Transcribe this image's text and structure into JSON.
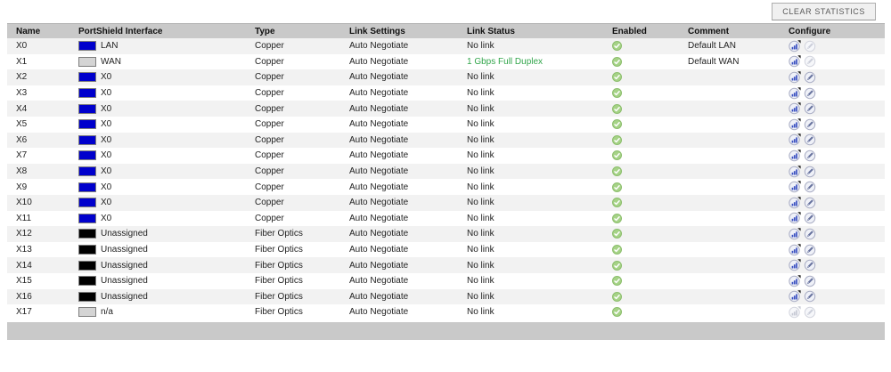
{
  "toolbar": {
    "clear_statistics_label": "CLEAR STATISTICS"
  },
  "table": {
    "columns": [
      "Name",
      "PortShield Interface",
      "Type",
      "Link Settings",
      "Link Status",
      "Enabled",
      "Comment",
      "Configure"
    ],
    "rows": [
      {
        "name": "X0",
        "portshield": {
          "color": "blue",
          "label": "LAN"
        },
        "type": "Copper",
        "link_settings": "Auto Negotiate",
        "link_status": "No link",
        "link_up": false,
        "enabled": true,
        "comment": "Default LAN",
        "configure": {
          "statistics": true,
          "edit": false
        }
      },
      {
        "name": "X1",
        "portshield": {
          "color": "gray",
          "label": "WAN"
        },
        "type": "Copper",
        "link_settings": "Auto Negotiate",
        "link_status": "1 Gbps Full Duplex",
        "link_up": true,
        "enabled": true,
        "comment": "Default WAN",
        "configure": {
          "statistics": true,
          "edit": false
        }
      },
      {
        "name": "X2",
        "portshield": {
          "color": "blue",
          "label": "X0"
        },
        "type": "Copper",
        "link_settings": "Auto Negotiate",
        "link_status": "No link",
        "link_up": false,
        "enabled": true,
        "comment": "",
        "configure": {
          "statistics": true,
          "edit": true
        }
      },
      {
        "name": "X3",
        "portshield": {
          "color": "blue",
          "label": "X0"
        },
        "type": "Copper",
        "link_settings": "Auto Negotiate",
        "link_status": "No link",
        "link_up": false,
        "enabled": true,
        "comment": "",
        "configure": {
          "statistics": true,
          "edit": true
        }
      },
      {
        "name": "X4",
        "portshield": {
          "color": "blue",
          "label": "X0"
        },
        "type": "Copper",
        "link_settings": "Auto Negotiate",
        "link_status": "No link",
        "link_up": false,
        "enabled": true,
        "comment": "",
        "configure": {
          "statistics": true,
          "edit": true
        }
      },
      {
        "name": "X5",
        "portshield": {
          "color": "blue",
          "label": "X0"
        },
        "type": "Copper",
        "link_settings": "Auto Negotiate",
        "link_status": "No link",
        "link_up": false,
        "enabled": true,
        "comment": "",
        "configure": {
          "statistics": true,
          "edit": true
        }
      },
      {
        "name": "X6",
        "portshield": {
          "color": "blue",
          "label": "X0"
        },
        "type": "Copper",
        "link_settings": "Auto Negotiate",
        "link_status": "No link",
        "link_up": false,
        "enabled": true,
        "comment": "",
        "configure": {
          "statistics": true,
          "edit": true
        }
      },
      {
        "name": "X7",
        "portshield": {
          "color": "blue",
          "label": "X0"
        },
        "type": "Copper",
        "link_settings": "Auto Negotiate",
        "link_status": "No link",
        "link_up": false,
        "enabled": true,
        "comment": "",
        "configure": {
          "statistics": true,
          "edit": true
        }
      },
      {
        "name": "X8",
        "portshield": {
          "color": "blue",
          "label": "X0"
        },
        "type": "Copper",
        "link_settings": "Auto Negotiate",
        "link_status": "No link",
        "link_up": false,
        "enabled": true,
        "comment": "",
        "configure": {
          "statistics": true,
          "edit": true
        }
      },
      {
        "name": "X9",
        "portshield": {
          "color": "blue",
          "label": "X0"
        },
        "type": "Copper",
        "link_settings": "Auto Negotiate",
        "link_status": "No link",
        "link_up": false,
        "enabled": true,
        "comment": "",
        "configure": {
          "statistics": true,
          "edit": true
        }
      },
      {
        "name": "X10",
        "portshield": {
          "color": "blue",
          "label": "X0"
        },
        "type": "Copper",
        "link_settings": "Auto Negotiate",
        "link_status": "No link",
        "link_up": false,
        "enabled": true,
        "comment": "",
        "configure": {
          "statistics": true,
          "edit": true
        }
      },
      {
        "name": "X11",
        "portshield": {
          "color": "blue",
          "label": "X0"
        },
        "type": "Copper",
        "link_settings": "Auto Negotiate",
        "link_status": "No link",
        "link_up": false,
        "enabled": true,
        "comment": "",
        "configure": {
          "statistics": true,
          "edit": true
        }
      },
      {
        "name": "X12",
        "portshield": {
          "color": "black",
          "label": "Unassigned"
        },
        "type": "Fiber Optics",
        "link_settings": "Auto Negotiate",
        "link_status": "No link",
        "link_up": false,
        "enabled": true,
        "comment": "",
        "configure": {
          "statistics": true,
          "edit": true
        }
      },
      {
        "name": "X13",
        "portshield": {
          "color": "black",
          "label": "Unassigned"
        },
        "type": "Fiber Optics",
        "link_settings": "Auto Negotiate",
        "link_status": "No link",
        "link_up": false,
        "enabled": true,
        "comment": "",
        "configure": {
          "statistics": true,
          "edit": true
        }
      },
      {
        "name": "X14",
        "portshield": {
          "color": "black",
          "label": "Unassigned"
        },
        "type": "Fiber Optics",
        "link_settings": "Auto Negotiate",
        "link_status": "No link",
        "link_up": false,
        "enabled": true,
        "comment": "",
        "configure": {
          "statistics": true,
          "edit": true
        }
      },
      {
        "name": "X15",
        "portshield": {
          "color": "black",
          "label": "Unassigned"
        },
        "type": "Fiber Optics",
        "link_settings": "Auto Negotiate",
        "link_status": "No link",
        "link_up": false,
        "enabled": true,
        "comment": "",
        "configure": {
          "statistics": true,
          "edit": true
        }
      },
      {
        "name": "X16",
        "portshield": {
          "color": "black",
          "label": "Unassigned"
        },
        "type": "Fiber Optics",
        "link_settings": "Auto Negotiate",
        "link_status": "No link",
        "link_up": false,
        "enabled": true,
        "comment": "",
        "configure": {
          "statistics": true,
          "edit": true
        }
      },
      {
        "name": "X17",
        "portshield": {
          "color": "gray",
          "label": "n/a"
        },
        "type": "Fiber Optics",
        "link_settings": "Auto Negotiate",
        "link_status": "No link",
        "link_up": false,
        "enabled": true,
        "comment": "",
        "configure": {
          "statistics": false,
          "edit": false
        }
      }
    ]
  },
  "colors": {
    "port_blue": "#0000CC",
    "port_black": "#000000",
    "port_gray": "#D4D4D4",
    "link_up_green": "#33A64C",
    "enabled_green": "#A6D387",
    "header_gray": "#C9C9C9",
    "stripe_gray": "#F2F2F2",
    "icon_blue": "#3A50C0"
  },
  "icons": {
    "enabled": "check-circle-icon",
    "statistics": "bar-chart-icon",
    "edit": "pencil-icon"
  }
}
